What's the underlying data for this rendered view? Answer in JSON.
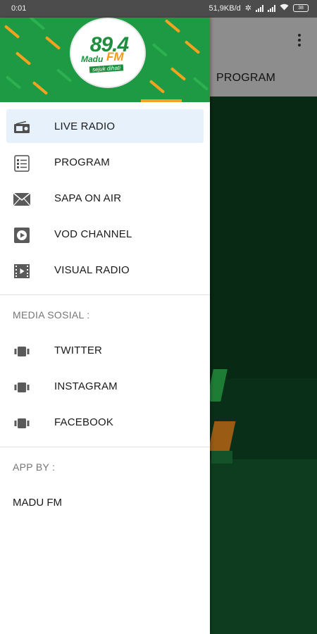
{
  "status_bar": {
    "time": "0:01",
    "network_speed": "51,9KB/d",
    "battery": "38"
  },
  "background_app": {
    "visible_tab": "PROGRAM"
  },
  "drawer": {
    "logo": {
      "number": "89.4",
      "name_part1": "Madu",
      "name_part2": "FM",
      "tagline": "sejuk dihati"
    },
    "menu_items": [
      {
        "label": "LIVE RADIO",
        "icon": "radio-icon",
        "active": true
      },
      {
        "label": "PROGRAM",
        "icon": "list-icon",
        "active": false
      },
      {
        "label": "SAPA ON AIR",
        "icon": "mail-icon",
        "active": false
      },
      {
        "label": "VOD CHANNEL",
        "icon": "play-icon",
        "active": false
      },
      {
        "label": "VISUAL RADIO",
        "icon": "film-icon",
        "active": false
      }
    ],
    "social_section": {
      "title": "MEDIA SOSIAL :",
      "items": [
        {
          "label": "TWITTER",
          "icon": "social-icon"
        },
        {
          "label": "INSTAGRAM",
          "icon": "social-icon"
        },
        {
          "label": "FACEBOOK",
          "icon": "social-icon"
        }
      ]
    },
    "app_by_section": {
      "title": "APP BY :",
      "item": "MADU FM"
    }
  },
  "colors": {
    "header_green": "#1e9a45",
    "accent_orange": "#f5a31f",
    "active_item_bg": "#e7f1fb",
    "icon_gray": "#4f4f4f"
  }
}
